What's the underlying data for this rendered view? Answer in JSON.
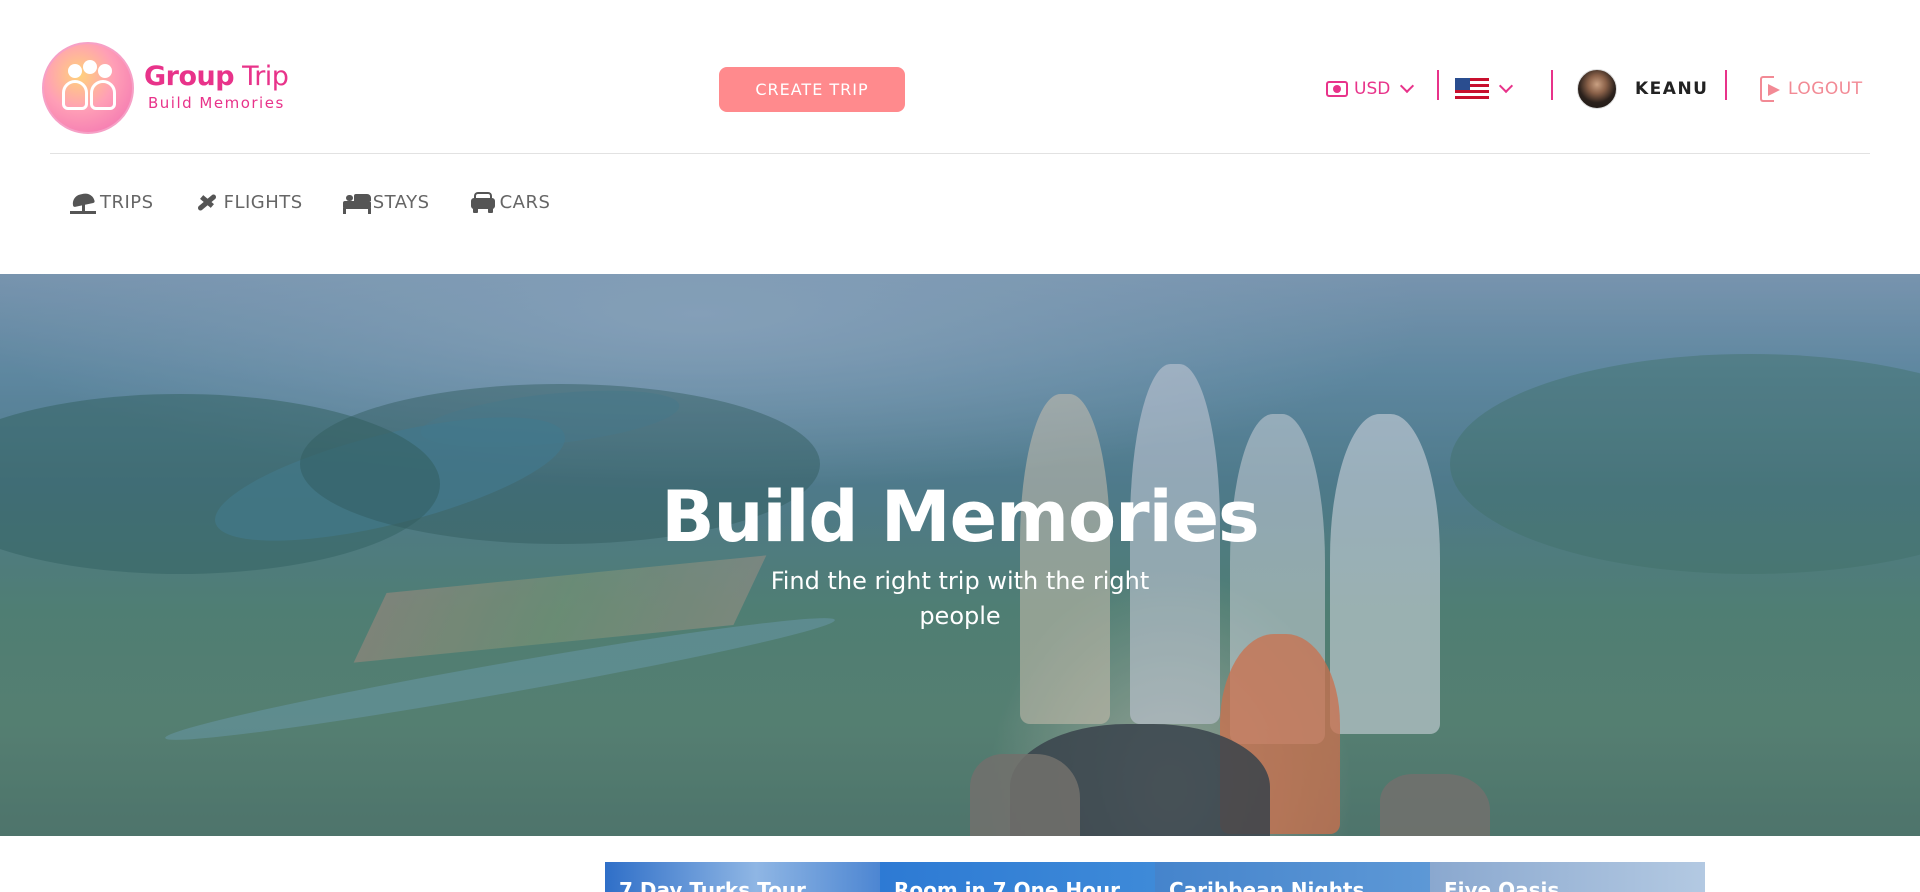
{
  "brand": {
    "title_bold": "Group",
    "title_light": "Trip",
    "tagline": "Build Memories"
  },
  "header": {
    "create_trip_label": "CREATE TRIP",
    "currency": {
      "label": "USD",
      "icon": "money-bill-icon"
    },
    "language": {
      "flag": "us-flag-icon"
    },
    "user": {
      "name": "KEANU"
    },
    "logout_label": "LOGOUT"
  },
  "nav": {
    "items": [
      {
        "label": "TRIPS",
        "icon": "umbrella-beach-icon"
      },
      {
        "label": "FLIGHTS",
        "icon": "plane-icon"
      },
      {
        "label": "STAYS",
        "icon": "bed-icon"
      },
      {
        "label": "CARS",
        "icon": "car-icon"
      }
    ]
  },
  "hero": {
    "title": "Build Memories",
    "subtitle": "Find the right trip with the right people"
  },
  "trip_cards": [
    {
      "title": "7 Day Turks Tour"
    },
    {
      "title": "Room in 7 One Hour"
    },
    {
      "title": "Caribbean Nights"
    },
    {
      "title": "Five Oasis"
    }
  ],
  "colors": {
    "brand_pink": "#e8338a",
    "button_coral": "#ff8a8d",
    "logout_pink": "#f28a95",
    "nav_gray": "#666666"
  }
}
